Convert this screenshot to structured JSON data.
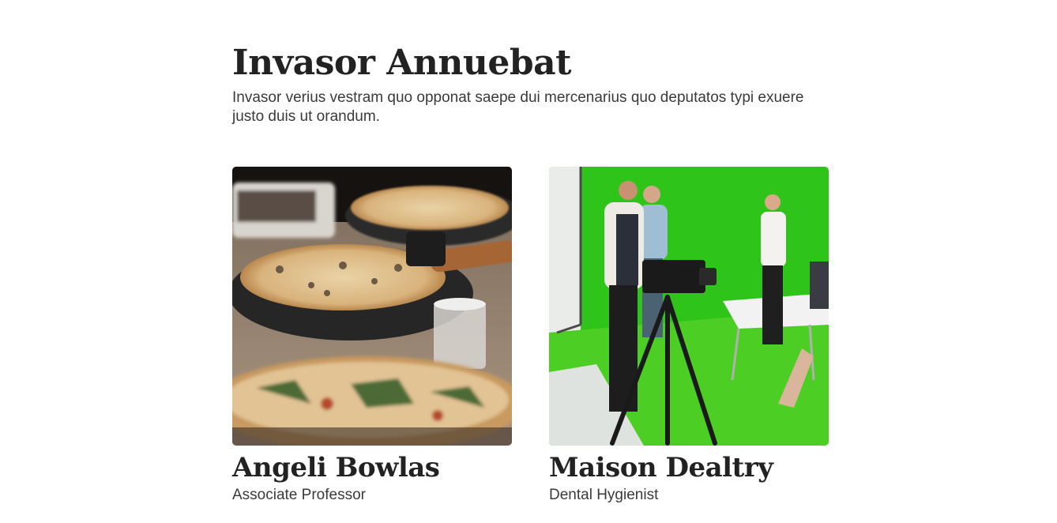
{
  "section": {
    "title": "Invasor Annuebat",
    "description": "Invasor verius vestram quo opponat saepe dui mercenarius quo deputatos typi exuere justo duis ut orandum."
  },
  "team": [
    {
      "name": "Angeli Bowlas",
      "role": "Associate Professor",
      "photo": "pizza-table-photo"
    },
    {
      "name": "Maison Dealtry",
      "role": "Dental Hygienist",
      "photo": "green-screen-studio-photo"
    }
  ],
  "colors": {
    "text": "#222222",
    "body_text": "#3a3a3a",
    "background": "#ffffff",
    "studio_green": "#3cc11d"
  }
}
